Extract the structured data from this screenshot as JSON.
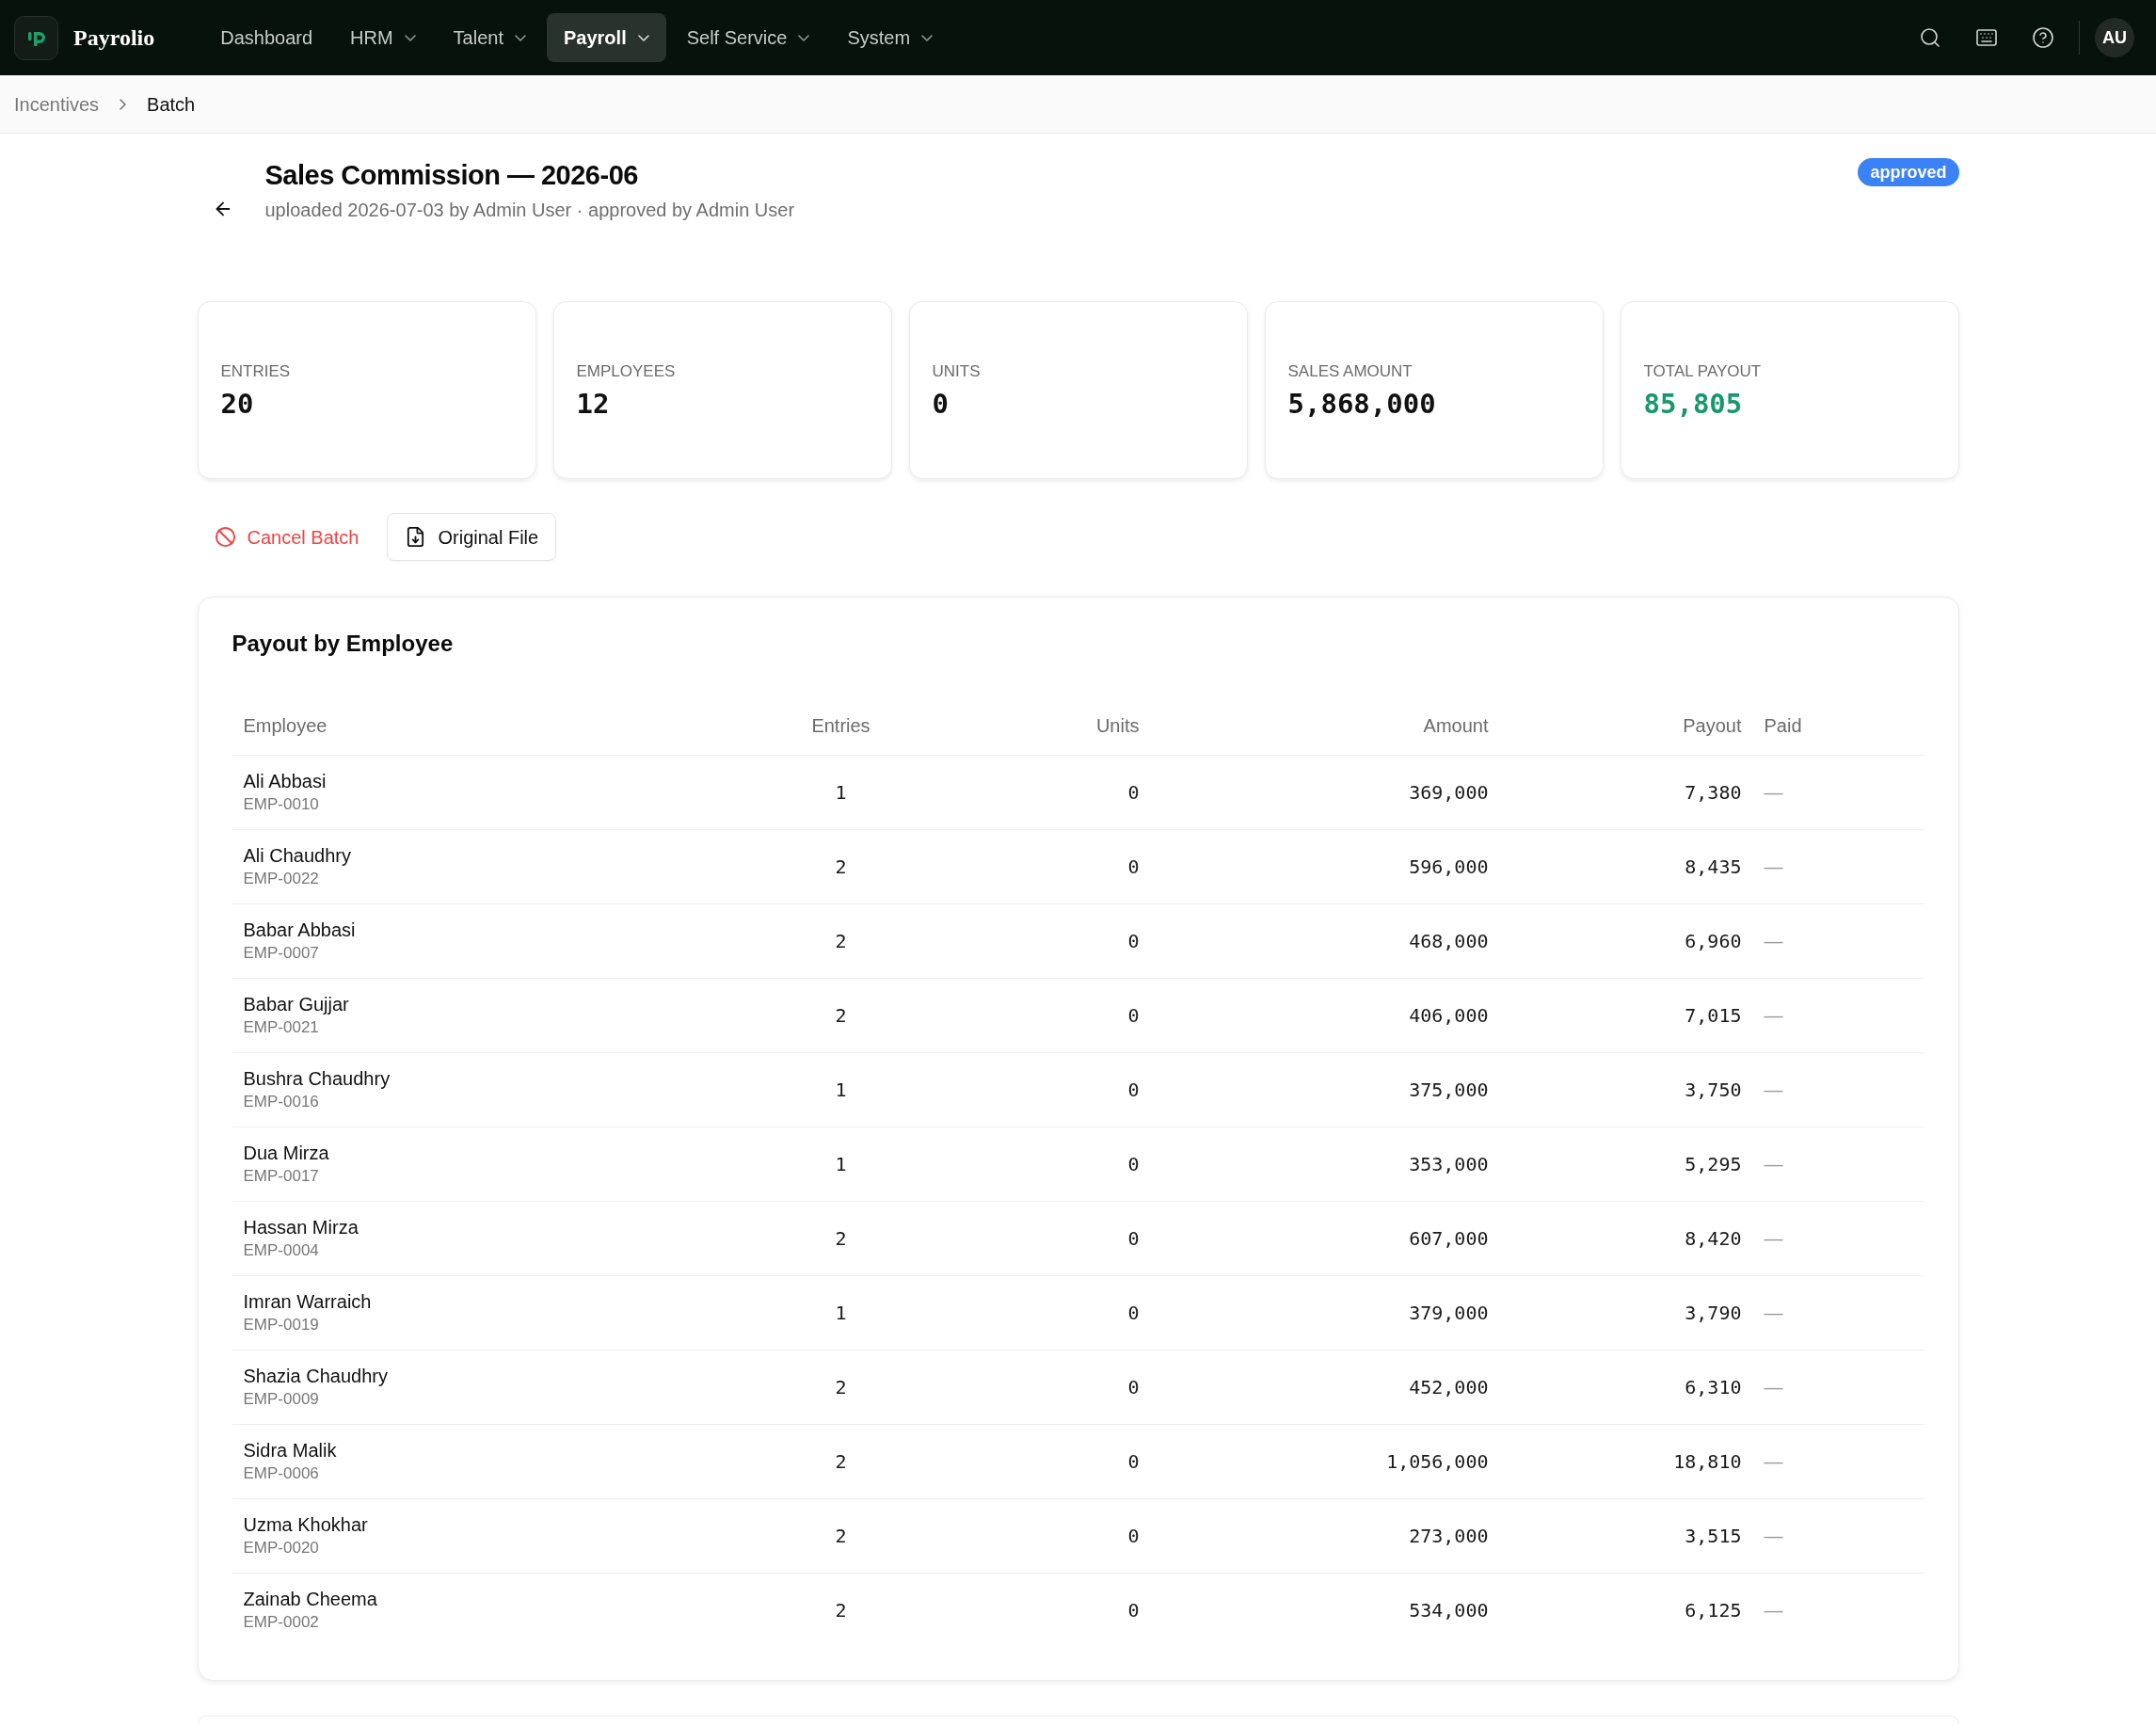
{
  "nav": {
    "brand": "Payrolio",
    "items": [
      {
        "label": "Dashboard",
        "dropdown": false,
        "selected": false
      },
      {
        "label": "HRM",
        "dropdown": true,
        "selected": false
      },
      {
        "label": "Talent",
        "dropdown": true,
        "selected": false
      },
      {
        "label": "Payroll",
        "dropdown": true,
        "selected": true
      },
      {
        "label": "Self Service",
        "dropdown": true,
        "selected": false
      },
      {
        "label": "System",
        "dropdown": true,
        "selected": false
      }
    ],
    "avatar": "AU"
  },
  "breadcrumb": [
    {
      "label": "Incentives",
      "current": false
    },
    {
      "label": "Batch",
      "current": true
    }
  ],
  "header": {
    "title": "Sales Commission — 2026-06",
    "subtitle": "uploaded 2026-07-03 by Admin User · approved by Admin User",
    "status": "approved"
  },
  "stats": [
    {
      "label": "ENTRIES",
      "value": "20",
      "color": "#111111"
    },
    {
      "label": "EMPLOYEES",
      "value": "12",
      "color": "#111111"
    },
    {
      "label": "UNITS",
      "value": "0",
      "color": "#111111"
    },
    {
      "label": "SALES AMOUNT",
      "value": "5,868,000",
      "color": "#111111"
    },
    {
      "label": "TOTAL PAYOUT",
      "value": "85,805",
      "color": "#16996a"
    }
  ],
  "actions": [
    {
      "label": "Cancel Batch",
      "kind": "danger"
    },
    {
      "label": "Original File",
      "kind": "download"
    }
  ],
  "payout_table": {
    "title": "Payout by Employee",
    "columns": [
      "Employee",
      "Entries",
      "Units",
      "Amount",
      "Payout",
      "Paid"
    ],
    "rows": [
      {
        "name": "Ali Abbasi",
        "code": "EMP-0010",
        "entries": "1",
        "units": "0",
        "amount": "369,000",
        "payout": "7,380",
        "paid": "—"
      },
      {
        "name": "Ali Chaudhry",
        "code": "EMP-0022",
        "entries": "2",
        "units": "0",
        "amount": "596,000",
        "payout": "8,435",
        "paid": "—"
      },
      {
        "name": "Babar Abbasi",
        "code": "EMP-0007",
        "entries": "2",
        "units": "0",
        "amount": "468,000",
        "payout": "6,960",
        "paid": "—"
      },
      {
        "name": "Babar Gujjar",
        "code": "EMP-0021",
        "entries": "2",
        "units": "0",
        "amount": "406,000",
        "payout": "7,015",
        "paid": "—"
      },
      {
        "name": "Bushra Chaudhry",
        "code": "EMP-0016",
        "entries": "1",
        "units": "0",
        "amount": "375,000",
        "payout": "3,750",
        "paid": "—"
      },
      {
        "name": "Dua Mirza",
        "code": "EMP-0017",
        "entries": "1",
        "units": "0",
        "amount": "353,000",
        "payout": "5,295",
        "paid": "—"
      },
      {
        "name": "Hassan Mirza",
        "code": "EMP-0004",
        "entries": "2",
        "units": "0",
        "amount": "607,000",
        "payout": "8,420",
        "paid": "—"
      },
      {
        "name": "Imran Warraich",
        "code": "EMP-0019",
        "entries": "1",
        "units": "0",
        "amount": "379,000",
        "payout": "3,790",
        "paid": "—"
      },
      {
        "name": "Shazia Chaudhry",
        "code": "EMP-0009",
        "entries": "2",
        "units": "0",
        "amount": "452,000",
        "payout": "6,310",
        "paid": "—"
      },
      {
        "name": "Sidra Malik",
        "code": "EMP-0006",
        "entries": "2",
        "units": "0",
        "amount": "1,056,000",
        "payout": "18,810",
        "paid": "—"
      },
      {
        "name": "Uzma Khokhar",
        "code": "EMP-0020",
        "entries": "2",
        "units": "0",
        "amount": "273,000",
        "payout": "3,515",
        "paid": "—"
      },
      {
        "name": "Zainab Cheema",
        "code": "EMP-0002",
        "entries": "2",
        "units": "0",
        "amount": "534,000",
        "payout": "6,125",
        "paid": "—"
      }
    ]
  }
}
